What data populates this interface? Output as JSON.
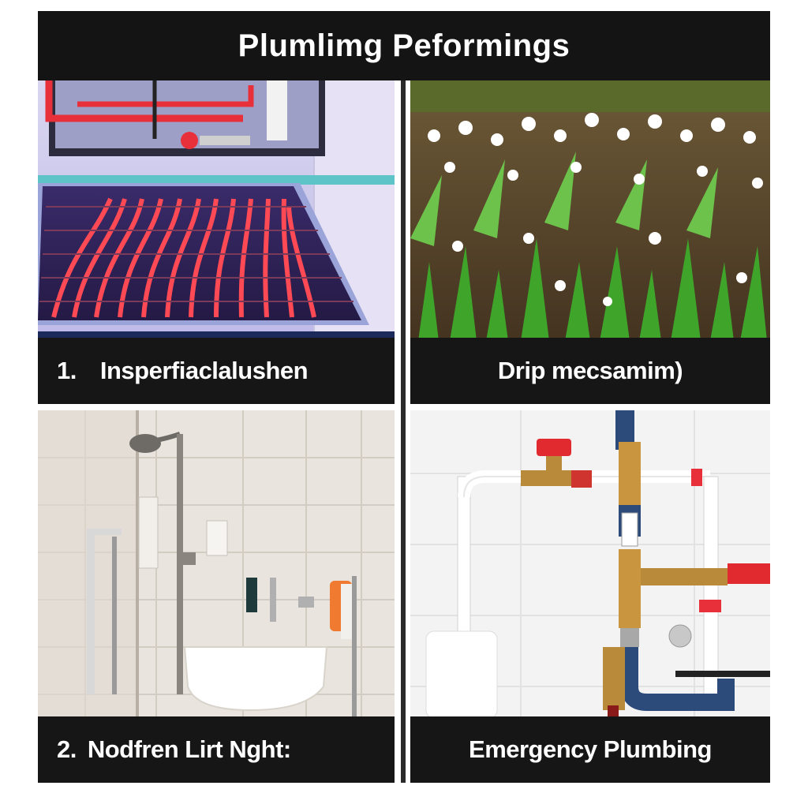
{
  "header": {
    "title": "Plumlimg  Peformings"
  },
  "panels": [
    {
      "number": "1.",
      "label": "Insperfiaclalushen"
    },
    {
      "number": "",
      "label": "Drip mecsamim)"
    },
    {
      "number": "2.",
      "label": "Nodfren Lirt Nght:"
    },
    {
      "number": "",
      "label": "Emergency Plumbing"
    }
  ],
  "colors": {
    "header_bg": "#141414",
    "caption_bg": "#161616",
    "heating_pipe": "#e8303a",
    "leaf_green": "#3fa52a",
    "brass": "#b88a3a"
  }
}
